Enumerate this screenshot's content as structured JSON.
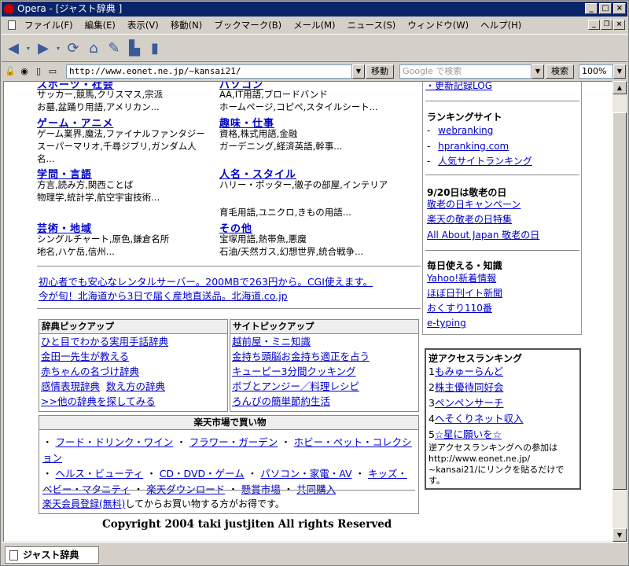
{
  "window": {
    "title": "Opera - [ジャスト辞典 ]",
    "btn_min": "_",
    "btn_max": "□",
    "btn_close": "×"
  },
  "menu": [
    "ファイル(F)",
    "編集(E)",
    "表示(V)",
    "移動(N)",
    "ブックマーク(B)",
    "メール(M)",
    "ニュース(S)",
    "ウィンドウ(W)",
    "ヘルプ(H)"
  ],
  "address": {
    "url": "http://www.eonet.ne.jp/~kansai21/",
    "go": "移動",
    "search_placeholder": "Google で検索",
    "search_btn": "検索",
    "zoom": "100%"
  },
  "categories": [
    {
      "sub": [
        "サッカー,競馬,クリスマス,宗派",
        "お墓,盆踊り用語,アメリカン..."
      ]
    },
    {
      "sub": [
        "AA,IT用語,ブロードバンド",
        "ホームページ,コピペ,スタイルシート..."
      ]
    },
    {
      "title": "ゲーム・アニメ",
      "sub": [
        "ゲーム業界,魔法,ファイナルファンタジー",
        "スーパーマリオ,千尋ジブリ,ガンダム人",
        "名..."
      ]
    },
    {
      "title": "趣味・仕事",
      "sub": [
        "資格,株式用語,金融",
        "ガーデニング,経済英語,幹事..."
      ]
    },
    {
      "title": "学問・言語",
      "sub": [
        "方言,読み方,関西ことば",
        "物理学,統計学,航空宇宙技術..."
      ]
    },
    {
      "title": "人名・スタイル",
      "sub": [
        "ハリー・ポッター,徹子の部屋,インテリア",
        "",
        "育毛用語,ユニクロ,きもの用語..."
      ]
    },
    {
      "title": "芸術・地域",
      "sub": [
        "シングルチャート,原色,鎌倉名所",
        "地名,ハケ岳,信州..."
      ]
    },
    {
      "title": "その他",
      "sub": [
        "宝塚用語,熱帯魚,悪魔",
        "石油/天然ガス,幻想世界,統合戦争..."
      ]
    }
  ],
  "ads": [
    "初心者でも安心なレンタルサーバー。200MBで263円から。CGI使えます。",
    "今が旬！北海道から3日で届く産地直送品。北海道.co.jp"
  ],
  "dict_pickup": {
    "title": "辞典ピックアップ",
    "items": [
      "ひと目でわかる実用手話辞典",
      "金田一先生が教える",
      "赤ちゃんの名づけ辞典",
      "感情表現辞典",
      "数え方の辞典",
      ">>他の辞典を探してみる"
    ]
  },
  "site_pickup": {
    "title": "サイトピックアップ",
    "items": [
      "越前屋・ミニ知識",
      "金持ち頭脳お金持ち適正を占う",
      "キューピー3分間クッキング",
      "ボブとアンジー／料理レシピ",
      "ろんびの簡単節約生活"
    ]
  },
  "rakuten": {
    "title": "楽天市場で買い物",
    "links": [
      "フード・ドリンク・ワイン",
      "フラワー・ガーデン",
      "ホビー・ペット・コレクション",
      "ヘルス・ビューティ",
      "CD・DVD・ゲーム",
      "パソコン・家電・AV",
      "キッズ・ベビー・マタニティ",
      "楽天ダウンロード",
      "懸賞市場",
      "共同購入"
    ],
    "member_link": "楽天会員登録(無料)",
    "member_text": "してからお買い物する方がお得です。"
  },
  "copyright": "Copyright 2004 taki justjiten All rights Reserved",
  "right": {
    "update": "・更新記録LOG",
    "rank_title": "ランキングサイト",
    "rank_items": [
      "webranking",
      "hpranking.com",
      "人気サイトランキング"
    ],
    "keiro_title": "9/20日は敬老の日",
    "keiro_items": [
      "敬老の日キャンペーン",
      "楽天の敬老の日特集",
      "All About Japan 敬老の日"
    ],
    "daily_title": "毎日使える・知識",
    "daily_items": [
      "Yahoo!新着情報",
      "ほぼ日刊イト新聞",
      "おくすり110番",
      "e-typing"
    ],
    "rev_title": "逆アクセスランキング",
    "rev_items": [
      {
        "n": "1",
        "t": "もみゅーらんど"
      },
      {
        "n": "2",
        "t": "株主優待同好会"
      },
      {
        "n": "3",
        "t": "ペンペンサーチ"
      },
      {
        "n": "4",
        "t": "へそくりネット収入"
      },
      {
        "n": "5",
        "t": "☆星に願いを☆"
      }
    ],
    "rev_note": [
      "逆アクセスランキングへの参加は",
      "http://www.eonet.ne.jp/",
      "~kansai21/にリンクを貼るだけで",
      "す。"
    ]
  },
  "status": {
    "tab": "ジャスト辞典"
  }
}
